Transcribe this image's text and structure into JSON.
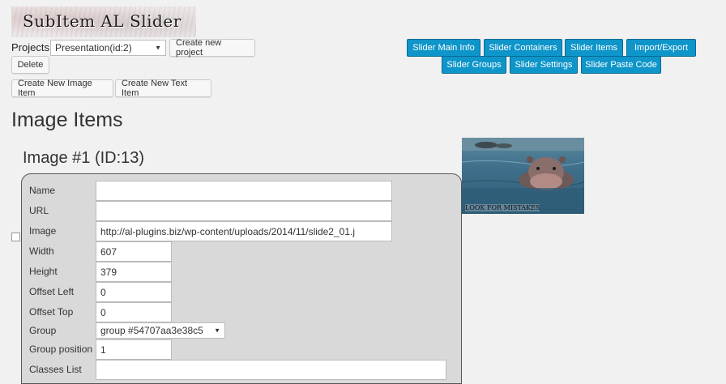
{
  "logo": {
    "text": "SubItem AL Slider"
  },
  "projects": {
    "label": "Projects",
    "selected": "Presentation(id:2)",
    "create_label": "Create new project",
    "delete_label": "Delete"
  },
  "create_buttons": {
    "image_item": "Create New Image Item",
    "text_item": "Create New Text Item"
  },
  "nav": [
    "Slider Main Info",
    "Slider Containers",
    "Slider Items",
    "Import/Export",
    "Slider Groups",
    "Slider Settings",
    "Slider Paste Code"
  ],
  "section_title": "Image Items",
  "item": {
    "heading": "Image #1  (ID:13)",
    "preview_caption": "LOOK FOR MISTAKES",
    "fields": {
      "name": {
        "label": "Name",
        "value": ""
      },
      "url": {
        "label": "URL",
        "value": ""
      },
      "image": {
        "label": "Image",
        "value": "http://al-plugins.biz/wp-content/uploads/2014/11/slide2_01.j"
      },
      "width": {
        "label": "Width",
        "value": "607"
      },
      "height": {
        "label": "Height",
        "value": "379"
      },
      "offset_left": {
        "label": "Offset Left",
        "value": "0"
      },
      "offset_top": {
        "label": "Offset Top",
        "value": "0"
      },
      "group": {
        "label": "Group",
        "value": "group #54707aa3e38c5"
      },
      "group_position": {
        "label": "Group position",
        "value": "1"
      },
      "classes_list": {
        "label": "Classes List",
        "value": ""
      }
    }
  },
  "colors": {
    "accent_blue": "#0e95c9",
    "page_bg": "#f1f1f1",
    "panel_bg": "#d9d9d9"
  },
  "icons": {
    "dropdown": "caret-down-icon"
  }
}
